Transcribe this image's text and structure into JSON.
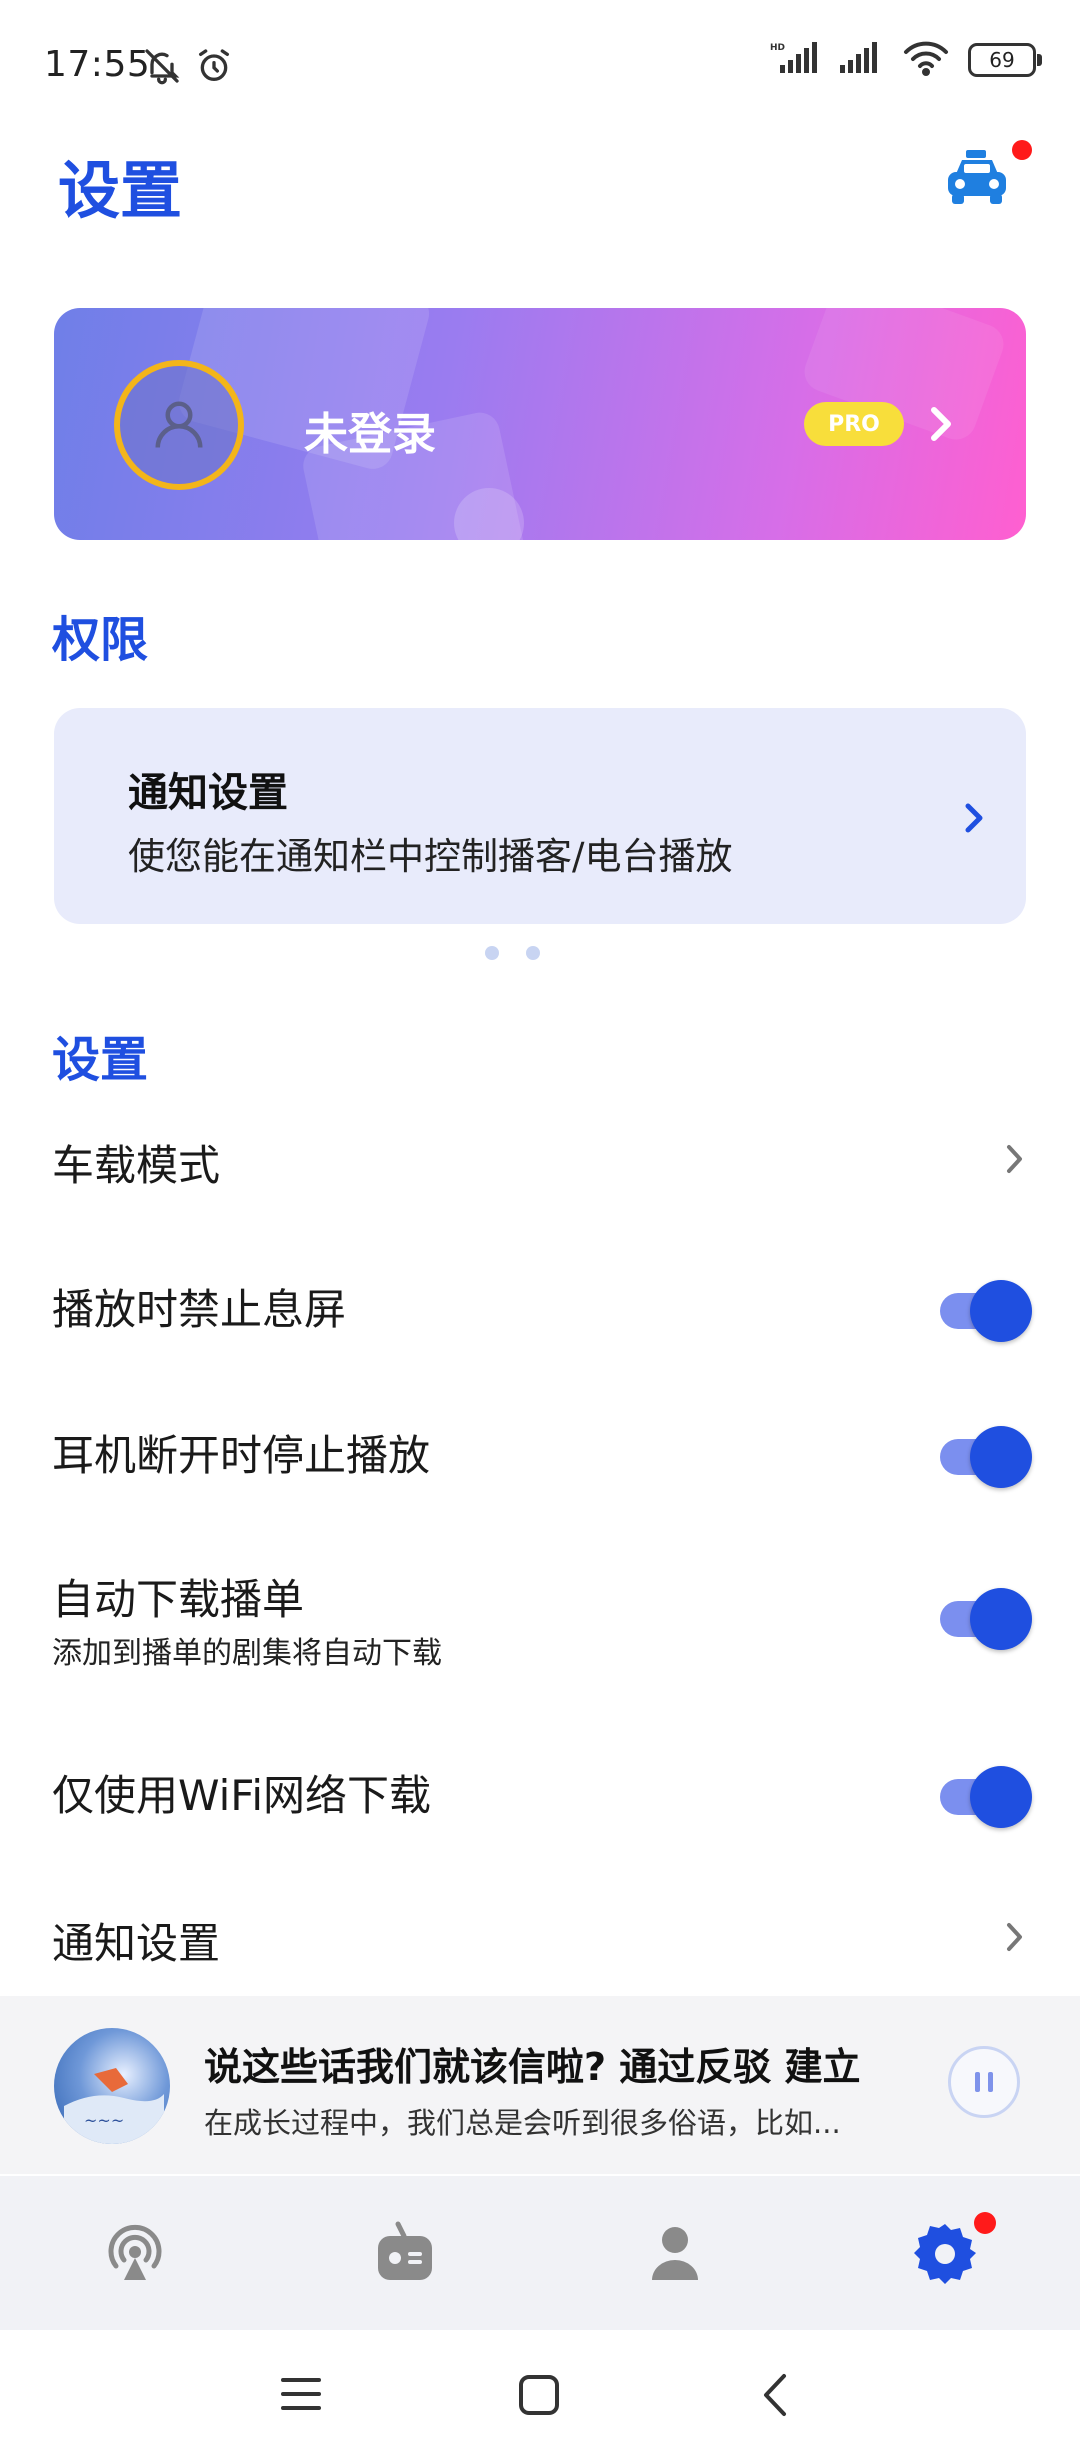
{
  "status_bar": {
    "time": "17:55",
    "battery": "69",
    "icons": [
      "bell-off-icon",
      "alarm-icon",
      "hd-signal-icon",
      "signal-icon",
      "wifi-icon",
      "battery-icon"
    ]
  },
  "header": {
    "title": "设置",
    "car_icon": "car-icon"
  },
  "profile": {
    "login_text": "未登录",
    "pro_badge": "PRO"
  },
  "permissions": {
    "section_title": "权限",
    "card_title": "通知设置",
    "card_desc": "使您能在通知栏中控制播客/电台播放"
  },
  "settings": {
    "section_title": "设置",
    "rows": [
      {
        "label": "车载模式",
        "type": "link"
      },
      {
        "label": "播放时禁止息屏",
        "type": "toggle",
        "on": true
      },
      {
        "label": "耳机断开时停止播放",
        "type": "toggle",
        "on": true
      },
      {
        "label": "自动下载播单",
        "sub": "添加到播单的剧集将自动下载",
        "type": "toggle",
        "on": true
      },
      {
        "label": "仅使用WiFi网络下载",
        "type": "toggle",
        "on": true
      },
      {
        "label": "通知设置",
        "type": "link"
      }
    ]
  },
  "player": {
    "title": "说这些话我们就该信啦? 通过反驳 建立",
    "subtitle": "在成长过程中，我们总是会听到很多俗语，比如..."
  },
  "bottom_nav": {
    "items": [
      "podcast-icon",
      "radio-icon",
      "profile-icon",
      "settings-icon"
    ],
    "active": "settings-icon"
  },
  "colors": {
    "accent": "#1f4fe0",
    "badge_red": "#ff1a1a",
    "pro_yellow": "#f8de3b"
  }
}
